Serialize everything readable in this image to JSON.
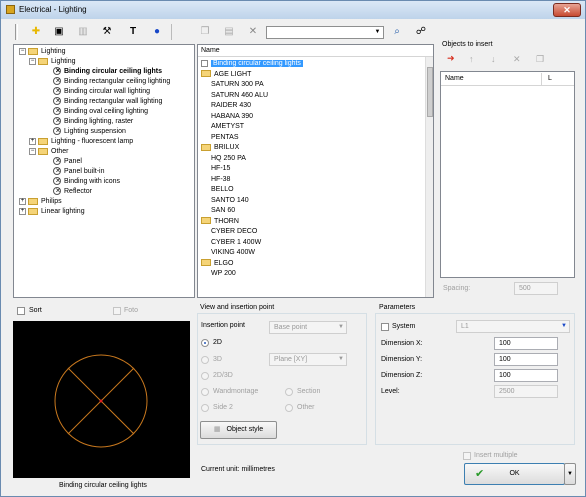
{
  "window": {
    "title": "Electrical - Lighting",
    "close_label": "✕"
  },
  "toolbar": {
    "search": {
      "value": "",
      "dropdown_glyph": "▼"
    },
    "icons": [
      "grip",
      "add-icon",
      "edit-icon",
      "delete-icon",
      "tools-icon",
      "text-icon",
      "help-icon",
      "copy-icon",
      "paste-icon",
      "cut-icon",
      "search-icon",
      "binoculars-icon"
    ]
  },
  "tree": {
    "root": "Lighting",
    "child": "Lighting",
    "items": [
      "Binding circular ceiling lights",
      "Binding rectangular ceiling lighting",
      "Binding circular wall lighting",
      "Binding rectangular wall lighting",
      "Binding oval ceiling lighting",
      "Binding lighting, raster",
      "Lighting suspension"
    ],
    "fluorescent": "Lighting - fluorescent lamp",
    "other": "Other",
    "other_items": [
      "Panel",
      "Panel built-in",
      "Binding with icons",
      "Reflector"
    ],
    "philips": "Philips",
    "linear": "Linear lighting"
  },
  "list": {
    "header": "Name",
    "rows": [
      {
        "type": "item",
        "label": "Binding circular ceiling lights"
      },
      {
        "type": "folder",
        "label": "AGE LIGHT"
      },
      {
        "type": "child",
        "label": "SATURN 300 PA"
      },
      {
        "type": "child",
        "label": "SATURN 460 ALU"
      },
      {
        "type": "child",
        "label": "RAIDER 430"
      },
      {
        "type": "child",
        "label": "HABANA 390"
      },
      {
        "type": "child",
        "label": "AMETYST"
      },
      {
        "type": "child",
        "label": "PENTAS"
      },
      {
        "type": "folder",
        "label": "BRILUX"
      },
      {
        "type": "child",
        "label": "HQ 250 PA"
      },
      {
        "type": "child",
        "label": "HF-15"
      },
      {
        "type": "child",
        "label": "HF-38"
      },
      {
        "type": "child",
        "label": "BELLO"
      },
      {
        "type": "child",
        "label": "SANTO 140"
      },
      {
        "type": "child",
        "label": "SAN 60"
      },
      {
        "type": "folder",
        "label": "THORN"
      },
      {
        "type": "child",
        "label": "CYBER DECO"
      },
      {
        "type": "child",
        "label": "CYBER 1 400W"
      },
      {
        "type": "child",
        "label": "VIKING 400W"
      },
      {
        "type": "folder",
        "label": "ELGO"
      },
      {
        "type": "child",
        "label": "WP 200"
      }
    ]
  },
  "objects": {
    "title": "Objects to insert",
    "col_name": "Name",
    "col_l": "L",
    "spacing_label": "Spacing:",
    "spacing_value": "500"
  },
  "sort_label": "Sort",
  "foto_label": "Foto",
  "preview_caption": "Binding circular ceiling lights",
  "view": {
    "title": "View and insertion point",
    "insertion_label": "Insertion point",
    "insertion_value": "Base point",
    "opt_2d": "2D",
    "opt_3d": "3D",
    "plane_value": "Plane  [XY]",
    "opt_2d3d": "2D/3D",
    "opt_wand": "Wandmontage",
    "opt_section": "Section",
    "opt_side2": "Side 2",
    "opt_other": "Other",
    "object_style": "Object style"
  },
  "params": {
    "title": "Parameters",
    "system_label": "System",
    "system_value": "L1",
    "dim_x_label": "Dimension X:",
    "dim_x": "100",
    "dim_y_label": "Dimension Y:",
    "dim_y": "100",
    "dim_z_label": "Dimension Z:",
    "dim_z": "100",
    "level_label": "Level:",
    "level": "2500"
  },
  "current_unit": "Current unit: millimetres",
  "insert_multiple": "Insert multiple",
  "ok_label": "OK",
  "colors": {
    "accent_red": "#d83020",
    "ok_green": "#2a9a2a",
    "preview_line": "#c8781e"
  }
}
